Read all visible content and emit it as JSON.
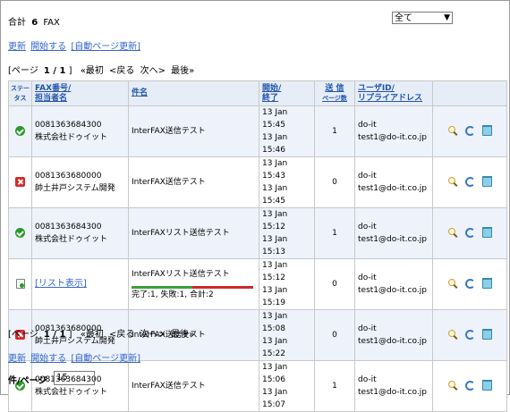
{
  "summary": {
    "label": "合計",
    "count": "6",
    "unit": "FAX"
  },
  "filter": {
    "selected": "全て"
  },
  "actions": {
    "refresh": "更新",
    "start": "開始する",
    "auto_refresh": "[自動ページ更新]"
  },
  "pager": {
    "open": "[ページ",
    "current": "1 / 1",
    "close": "]",
    "first": "«最初",
    "prev": "<戻る",
    "next": "次へ>",
    "last": "最後»"
  },
  "columns": {
    "status": "ステータス",
    "fax_line1": "FAX番号/",
    "fax_line2": "担当者名",
    "subject": "件名",
    "time_line1": "開始/",
    "time_line2": "終了",
    "sent_line1": "送 信",
    "sent_line2": "ページ数",
    "user_line1": "ユーザID/",
    "user_line2": "リプライアドレス"
  },
  "rows": [
    {
      "status": "success",
      "fax": "0081363684300",
      "name": "株式会社ドゥイット",
      "subject": "InterFAX送信テスト",
      "start": "13 Jan 15:45",
      "end": "13 Jan 15:46",
      "pages": "1",
      "user": "do-it",
      "reply": "test1@do-it.co.jp"
    },
    {
      "status": "error",
      "fax": "0081363680000",
      "name": "帥土井戸システム開発",
      "subject": "InterFAX送信テスト",
      "start": "13 Jan 15:43",
      "end": "13 Jan 15:45",
      "pages": "0",
      "user": "do-it",
      "reply": "test1@do-it.co.jp"
    },
    {
      "status": "success",
      "fax": "0081363684300",
      "name": "株式会社ドゥイット",
      "subject": "InterFAXリスト送信テスト",
      "start": "13 Jan 15:12",
      "end": "13 Jan 15:13",
      "pages": "1",
      "user": "do-it",
      "reply": "test1@do-it.co.jp"
    },
    {
      "status": "list",
      "list_link": "[リスト表示]",
      "subject": "InterFAXリスト送信テスト",
      "result": "完了:1, 失敗:1, 合計:2",
      "progress_complete": 0.5,
      "start": "13 Jan 15:12",
      "end": "13 Jan 15:19",
      "pages": "0",
      "user": "do-it",
      "reply": "test1@do-it.co.jp"
    },
    {
      "status": "error",
      "fax": "0081363680000",
      "name": "帥土井戸システム開発",
      "subject": "InterFAX送信テスト",
      "start": "13 Jan 15:08",
      "end": "13 Jan 15:22",
      "pages": "0",
      "user": "do-it",
      "reply": "test1@do-it.co.jp"
    },
    {
      "status": "success",
      "fax": "0081363684300",
      "name": "株式会社ドゥイット",
      "subject": "InterFAX送信テスト",
      "start": "13 Jan 15:06",
      "end": "13 Jan 15:07",
      "pages": "1",
      "user": "do-it",
      "reply": "test1@do-it.co.jp"
    }
  ],
  "perpage": {
    "label": "件/ページ",
    "value": "15"
  },
  "colors": {
    "link": "#3366cc",
    "success": "#2a9a2a",
    "error": "#d42a2a",
    "header_bg": "#e6edf7"
  }
}
